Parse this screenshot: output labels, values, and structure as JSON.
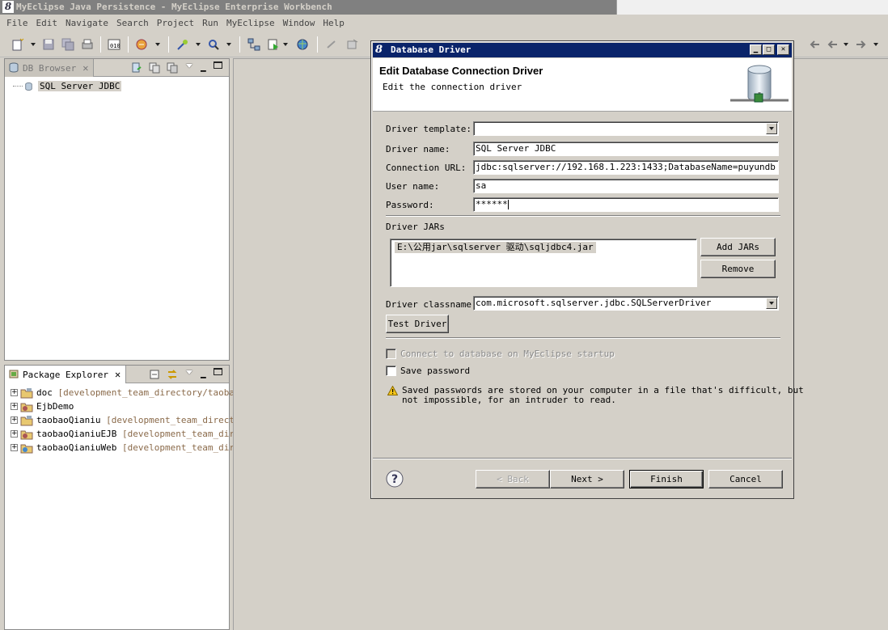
{
  "window": {
    "title": "MyEclipse Java Persistence - MyEclipse Enterprise Workbench"
  },
  "menu": [
    "File",
    "Edit",
    "Navigate",
    "Search",
    "Project",
    "Run",
    "MyEclipse",
    "Window",
    "Help"
  ],
  "db_browser": {
    "tab_label": "DB Browser",
    "items": [
      {
        "label": "SQL Server JDBC"
      }
    ]
  },
  "package_explorer": {
    "tab_label": "Package Explorer",
    "items": [
      {
        "name": "doc",
        "suffix": "[development_team_directory/taobaoW"
      },
      {
        "name": "EjbDemo",
        "suffix": ""
      },
      {
        "name": "taobaoQianiu",
        "suffix": "[development_team_director"
      },
      {
        "name": "taobaoQianiuEJB",
        "suffix": "[development_team_direc"
      },
      {
        "name": "taobaoQianiuWeb",
        "suffix": "[development_team_direc"
      }
    ]
  },
  "dialog": {
    "title": "Database Driver",
    "header_title": "Edit Database Connection Driver",
    "header_subtitle": "Edit the connection driver",
    "labels": {
      "template": "Driver template:",
      "name": "Driver name:",
      "url": "Connection URL:",
      "user": "User name:",
      "password": "Password:",
      "jars": "Driver JARs",
      "classname": "Driver classname:"
    },
    "values": {
      "template": "",
      "name": "SQL Server JDBC",
      "url": "jdbc:sqlserver://192.168.1.223:1433;DatabaseName=puyundb",
      "user": "sa",
      "password": "******",
      "classname": "com.microsoft.sqlserver.jdbc.SQLServerDriver"
    },
    "jar_list": [
      "E:\\公用jar\\sqlserver 驱动\\sqljdbc4.jar"
    ],
    "buttons": {
      "add_jars": "Add JARs",
      "remove": "Remove",
      "test_driver": "Test Driver",
      "back": "< Back",
      "next": "Next >",
      "finish": "Finish",
      "cancel": "Cancel"
    },
    "checkboxes": {
      "connect_on_startup": {
        "label": "Connect to database on MyEclipse startup",
        "checked": false,
        "enabled": false
      },
      "save_password": {
        "label": "Save password",
        "checked": false,
        "enabled": true
      }
    },
    "warning_text_line1": "Saved passwords are stored on your computer in a file that's difficult, but",
    "warning_text_line2": "not impossible, for an intruder to read."
  }
}
